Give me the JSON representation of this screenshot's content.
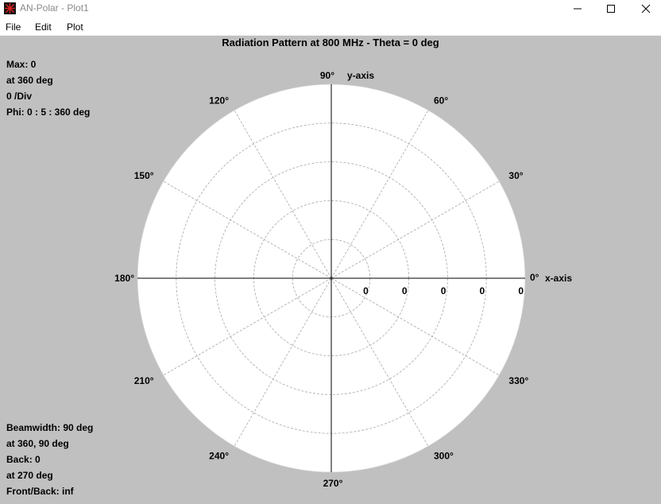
{
  "window": {
    "title": "AN-Polar - Plot1",
    "app_icon": "red-star-icon",
    "controls": [
      "minimize-icon",
      "maximize-icon",
      "close-icon"
    ]
  },
  "menu": {
    "items": [
      {
        "label": "File"
      },
      {
        "label": "Edit"
      },
      {
        "label": "Plot"
      }
    ]
  },
  "plot": {
    "title": "Radiation Pattern at 800 MHz - Theta = 0 deg",
    "info_top": [
      "Max: 0",
      "at 360 deg",
      "0 /Div",
      "Phi: 0 : 5 : 360 deg"
    ],
    "info_bottom": [
      "Beamwidth: 90 deg",
      "at 360, 90 deg",
      "Back: 0",
      "at 270 deg",
      "Front/Back: inf"
    ],
    "axis_x_label": "x-axis",
    "axis_y_label": "y-axis",
    "colors": {
      "background": "#c0c0c0",
      "plot_face": "#ffffff",
      "grid": "#a8a8a8",
      "axes": "#000000"
    }
  },
  "chart_data": {
    "type": "polar",
    "angle_labels": [
      "0°",
      "30°",
      "60°",
      "90°",
      "120°",
      "150°",
      "180°",
      "210°",
      "240°",
      "270°",
      "300°",
      "330°"
    ],
    "angles_deg": [
      0,
      30,
      60,
      90,
      120,
      150,
      180,
      210,
      240,
      270,
      300,
      330
    ],
    "ring_labels": [
      "0",
      "0",
      "0",
      "0",
      "0"
    ],
    "rings": 5,
    "grid": true,
    "phi_range": [
      0,
      360
    ],
    "phi_step": 5
  }
}
